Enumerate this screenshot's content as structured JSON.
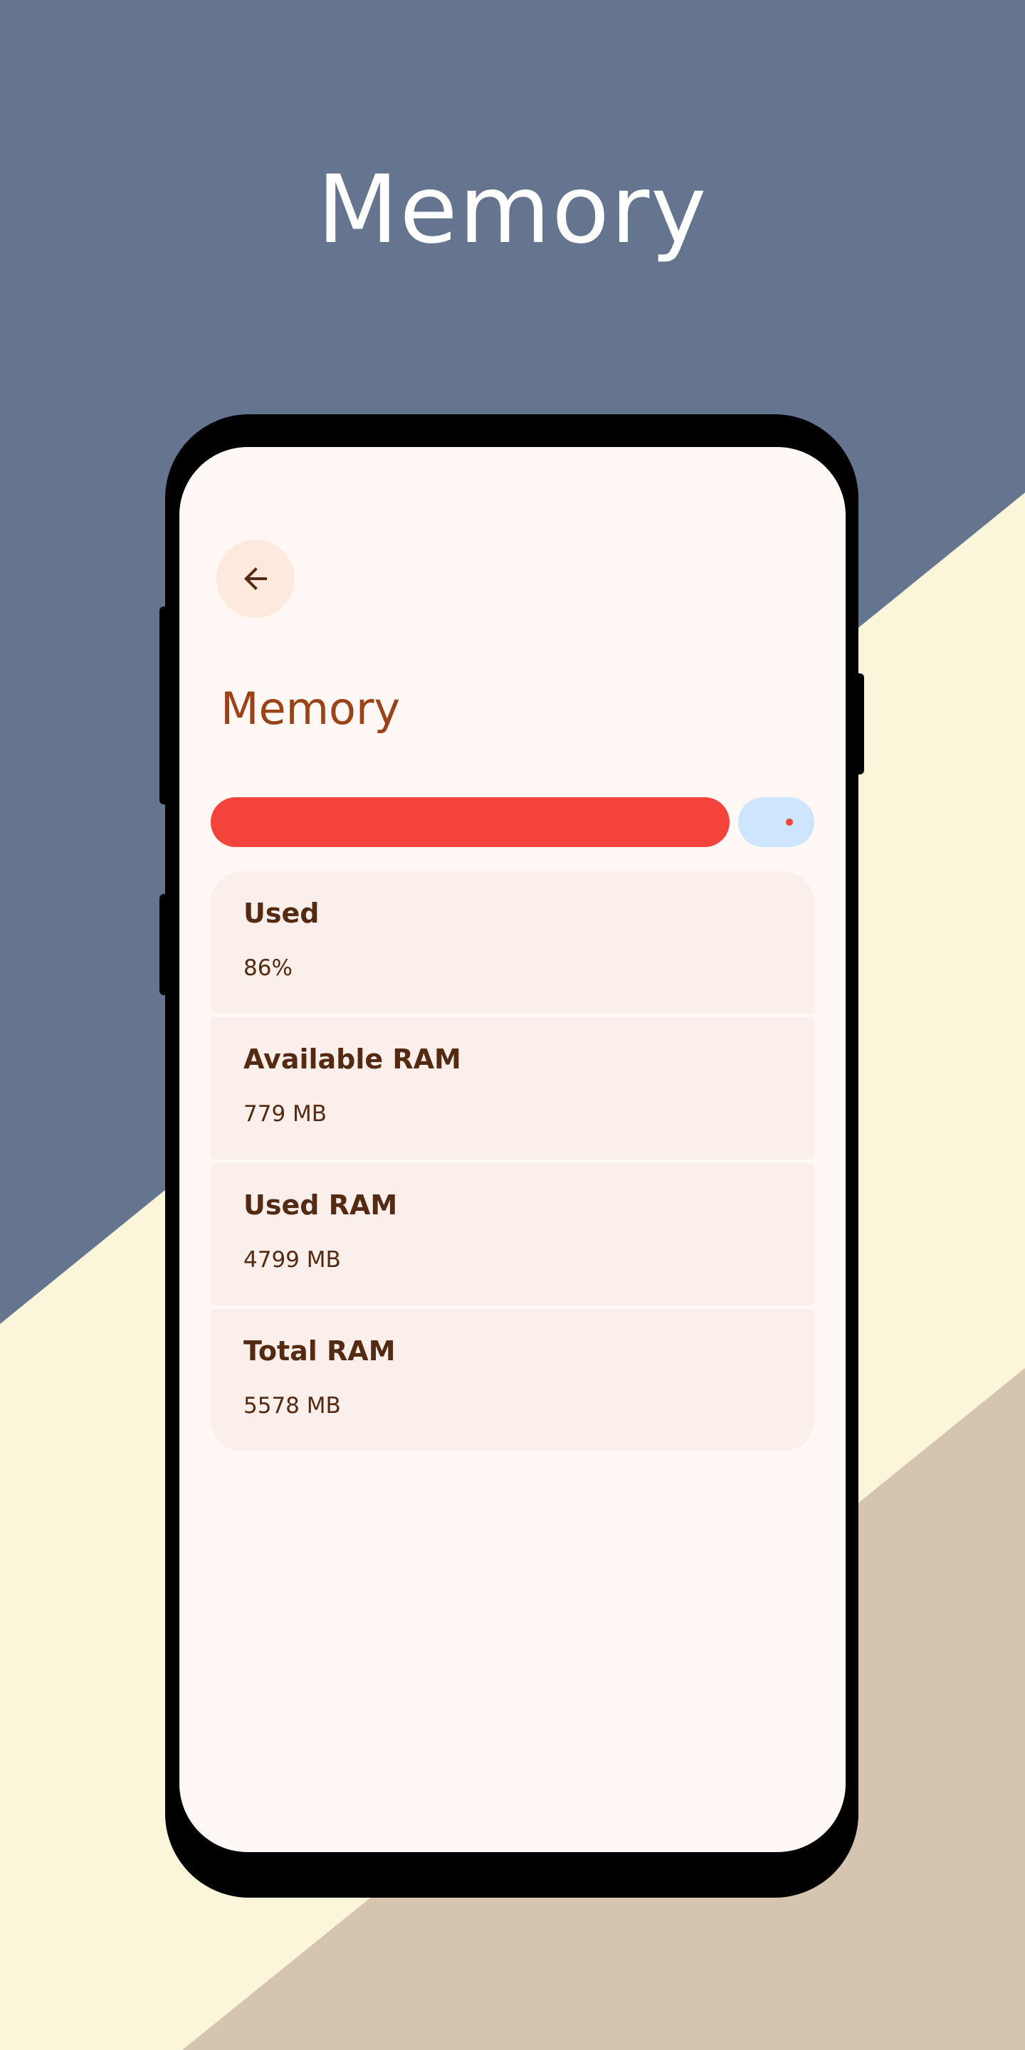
{
  "hero": {
    "title": "Memory"
  },
  "colors": {
    "background_blue": "#65748f",
    "background_cream": "#fbf5d9",
    "background_tan": "#d5c5ae",
    "screen_bg": "#fff8f5",
    "accent_red": "#f4433a",
    "track_blue": "#cde6fd",
    "title_brown": "#9c4218",
    "text_dark_brown": "#542a12",
    "card_bg": "#fbefeb",
    "back_button_bg": "#fde9dd"
  },
  "app": {
    "back_icon": "arrow-back-icon",
    "title": "Memory",
    "memory_usage": {
      "fraction_used": 0.86
    },
    "items": [
      {
        "label": "Used",
        "value": "86%"
      },
      {
        "label": "Available RAM",
        "value": "779 MB"
      },
      {
        "label": "Used RAM",
        "value": "4799 MB"
      },
      {
        "label": "Total RAM",
        "value": "5578 MB"
      }
    ]
  }
}
